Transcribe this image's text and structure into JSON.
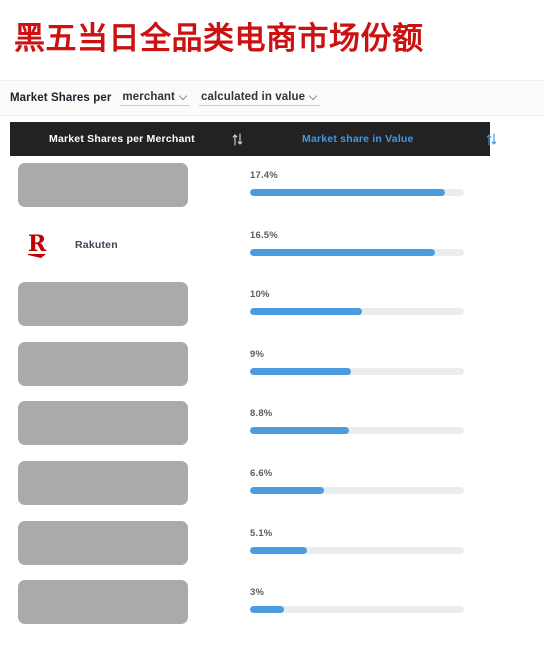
{
  "title": "黑五当日全品类电商市场份额",
  "theme": {
    "title_color": "#cc1111",
    "header_bg": "#222222",
    "header_accent": "#3d9ae8",
    "bar_fill": "#4a9bdf",
    "bar_track": "#eaedef",
    "redaction": "#aaaaaa"
  },
  "filter": {
    "label": "Market Shares per",
    "dropdown_dimension": "merchant",
    "dropdown_metric": "calculated in value",
    "chevron_icon": "chevron-down-icon"
  },
  "table": {
    "col_merchant": "Market Shares per Merchant",
    "col_value": "Market share in Value",
    "sort_icon": "sort-updown-icon"
  },
  "chart_data": {
    "type": "bar",
    "title": "黑五当日全品类电商市场份额",
    "xlabel": "",
    "ylabel": "Market share in Value",
    "orientation": "horizontal",
    "value_suffix": "%",
    "max_scale": 19.1,
    "categories": [
      "[redacted]",
      "Rakuten",
      "[redacted]",
      "[redacted]",
      "[redacted]",
      "[redacted]",
      "[redacted]",
      "[redacted]"
    ],
    "values": [
      17.4,
      16.5,
      10,
      9,
      8.8,
      6.6,
      5.1,
      3
    ],
    "labels": [
      "17.4%",
      "16.5%",
      "10%",
      "9%",
      "8.8%",
      "6.6%",
      "5.1%",
      "3%"
    ]
  },
  "rows": [
    {
      "merchant": "",
      "redacted": true,
      "label": "17.4%",
      "value": 17.4,
      "fill_pct": 91.1
    },
    {
      "merchant": "Rakuten",
      "redacted": false,
      "logo": "rakuten-logo-icon",
      "label": "16.5%",
      "value": 16.5,
      "fill_pct": 86.4
    },
    {
      "merchant": "",
      "redacted": true,
      "label": "10%",
      "value": 10,
      "fill_pct": 52.4
    },
    {
      "merchant": "",
      "redacted": true,
      "label": "9%",
      "value": 9,
      "fill_pct": 47.1
    },
    {
      "merchant": "",
      "redacted": true,
      "label": "8.8%",
      "value": 8.8,
      "fill_pct": 46.1
    },
    {
      "merchant": "",
      "redacted": true,
      "label": "6.6%",
      "value": 6.6,
      "fill_pct": 34.6
    },
    {
      "merchant": "",
      "redacted": true,
      "label": "5.1%",
      "value": 5.1,
      "fill_pct": 26.7
    },
    {
      "merchant": "",
      "redacted": true,
      "label": "3%",
      "value": 3,
      "fill_pct": 15.7
    }
  ]
}
